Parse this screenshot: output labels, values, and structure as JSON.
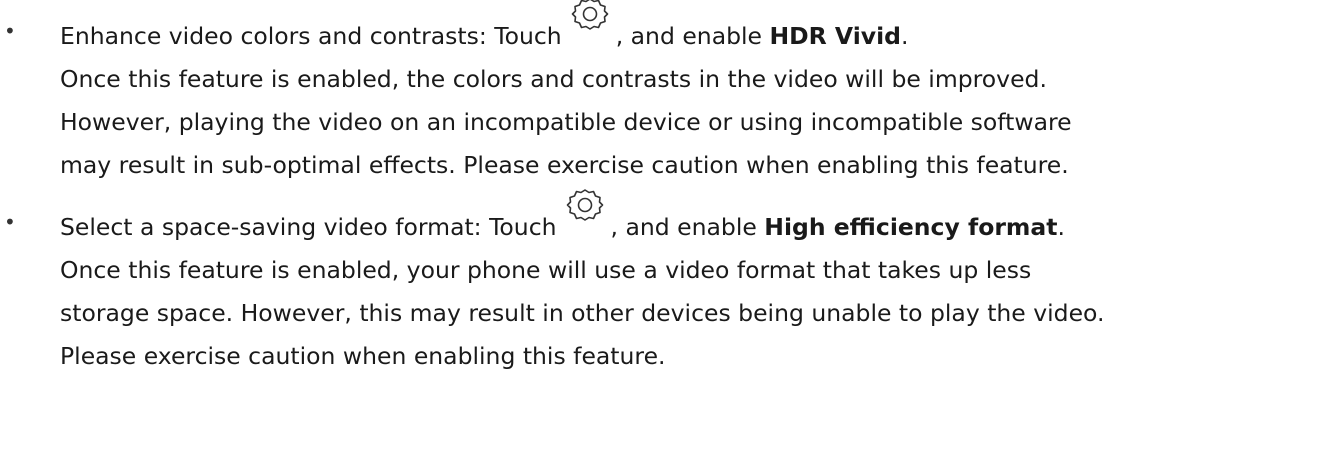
{
  "items": [
    {
      "lead_before_icon": "Enhance video colors and contrasts: Touch",
      "icon": "gear-icon",
      "lead_after_icon": ", and enable ",
      "setting_name": "HDR Vivid",
      "lead_end": ".",
      "lines": [
        "Once this feature is enabled, the colors and contrasts in the video will be improved.",
        "However, playing the video on an incompatible device or using incompatible software",
        "may result in sub-optimal effects. Please exercise caution when enabling this feature."
      ]
    },
    {
      "lead_before_icon": "Select a space-saving video format: Touch",
      "icon": "gear-icon",
      "lead_after_icon": ", and enable ",
      "setting_name": "High efficiency format",
      "lead_end": ".",
      "lines": [
        "Once this feature is enabled, your phone will use a video format that takes up less",
        "storage space. However, this may result in other devices being unable to play the video.",
        "Please exercise caution when enabling this feature."
      ]
    }
  ],
  "bullet_char": "•"
}
